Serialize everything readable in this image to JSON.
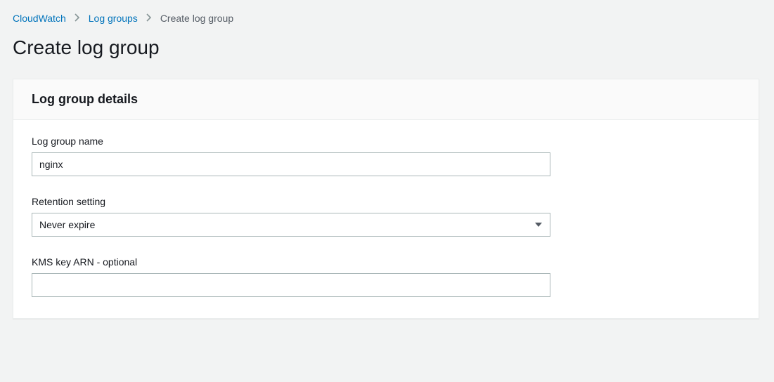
{
  "breadcrumb": {
    "items": [
      {
        "label": "CloudWatch",
        "link": true
      },
      {
        "label": "Log groups",
        "link": true
      },
      {
        "label": "Create log group",
        "link": false
      }
    ]
  },
  "page": {
    "title": "Create log group"
  },
  "panel": {
    "title": "Log group details",
    "fields": {
      "logGroupName": {
        "label": "Log group name",
        "value": "nginx"
      },
      "retention": {
        "label": "Retention setting",
        "value": "Never expire"
      },
      "kmsKey": {
        "label": "KMS key ARN - optional",
        "value": ""
      }
    }
  }
}
